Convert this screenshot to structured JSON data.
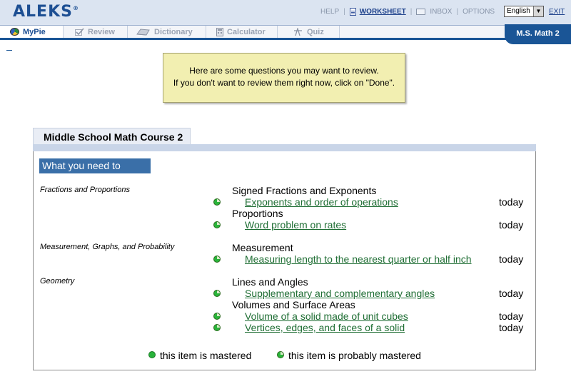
{
  "header": {
    "logo": "ALEKS",
    "logo_mark": "®",
    "links": {
      "help": "HELP",
      "worksheet": "WORKSHEET",
      "inbox": "INBOX",
      "options": "OPTIONS",
      "exit": "EXIT"
    },
    "language": "English"
  },
  "nav": {
    "tabs": [
      {
        "label": "MyPie"
      },
      {
        "label": "Review"
      },
      {
        "label": "Dictionary"
      },
      {
        "label": "Calculator"
      },
      {
        "label": "Quiz"
      }
    ],
    "course_badge": "M.S. Math 2"
  },
  "message": {
    "line1": "Here are some questions you may want to review.",
    "line2": "If you don't want to review them right now, click on \"Done\"."
  },
  "course": {
    "title": "Middle School Math Course 2",
    "review_heading": "What you need to review",
    "categories": [
      {
        "name": "Fractions and Proportions",
        "topics": [
          {
            "name": "Signed Fractions and Exponents",
            "items": [
              {
                "label": "Exponents and order of operations",
                "when": "today"
              }
            ]
          },
          {
            "name": "Proportions",
            "items": [
              {
                "label": "Word problem on rates",
                "when": "today"
              }
            ]
          }
        ]
      },
      {
        "name": "Measurement, Graphs, and Probability",
        "topics": [
          {
            "name": "Measurement",
            "items": [
              {
                "label": "Measuring length to the nearest quarter or half inch",
                "when": "today"
              }
            ]
          }
        ]
      },
      {
        "name": "Geometry",
        "topics": [
          {
            "name": "Lines and Angles",
            "items": [
              {
                "label": "Supplementary and complementary angles",
                "when": "today"
              }
            ]
          },
          {
            "name": "Volumes and Surface Areas",
            "items": [
              {
                "label": "Volume of a solid made of unit cubes",
                "when": "today"
              },
              {
                "label": "Vertices, edges, and faces of a solid",
                "when": "today"
              }
            ]
          }
        ]
      }
    ]
  },
  "legend": {
    "mastered": "this item is mastered",
    "probably_mastered": "this item is probably mastered"
  },
  "colors": {
    "accent": "#1a5596",
    "link_green": "#1f6e34",
    "mastered_green": "#28b23a",
    "message_bg": "#f2efb1"
  },
  "icons": {
    "mypie": "pie-chart-icon",
    "review": "checkmark-icon",
    "dictionary": "book-icon",
    "calculator": "calculator-icon",
    "quiz": "quiz-icon",
    "worksheet": "document-icon",
    "inbox": "envelope-icon"
  }
}
